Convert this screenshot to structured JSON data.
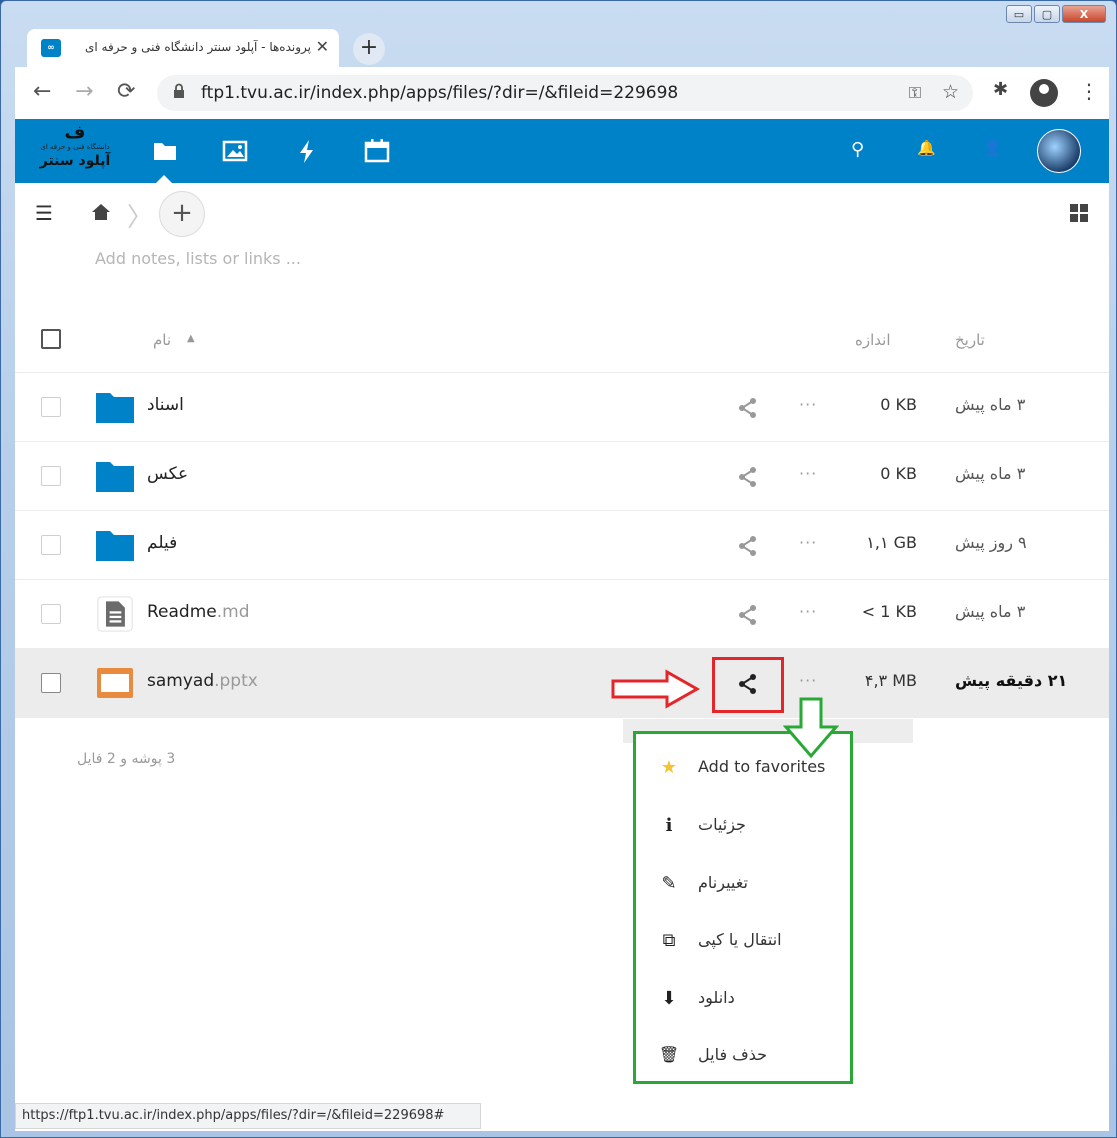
{
  "window": {
    "controls": {
      "minimize": "▭",
      "maximize": "▢",
      "close": "X"
    }
  },
  "tab": {
    "favicon_text": "∞",
    "title": "پرونده‌ها - آپلود سنتر دانشگاه فنی و حرفه ای",
    "close_glyph": "✕",
    "new_tab_glyph": "+"
  },
  "toolbar": {
    "back_glyph": "←",
    "forward_glyph": "→",
    "reload_glyph": "⟳",
    "url": "ftp1.tvu.ac.ir/index.php/apps/files/?dir=/&fileid=229698",
    "key_glyph": "⚿",
    "star_glyph": "☆",
    "extensions_glyph": "✱",
    "menu_glyph": "⋮"
  },
  "header": {
    "logo_mark": "ف",
    "logo_subtext": "دانشگاه فنی و حرفه ای",
    "logo_text": "آپلود سنتر",
    "search_glyph": "⚲",
    "bell_glyph": "🔔",
    "contacts_glyph": "👤"
  },
  "breadcrumb": {
    "hamburger_glyph": "☰",
    "separator": "〉",
    "add_glyph": "+"
  },
  "notes": {
    "placeholder": "Add notes, lists or links ..."
  },
  "list_header": {
    "name": "نام",
    "sort_glyph": "▲",
    "size": "اندازه",
    "date": "تاریخ"
  },
  "files": [
    {
      "name": "اسناد",
      "ext": "",
      "type": "folder",
      "size": "0 KB",
      "date": "۳ ماه پیش"
    },
    {
      "name": "عکس",
      "ext": "",
      "type": "folder",
      "size": "0 KB",
      "date": "۳ ماه پیش"
    },
    {
      "name": "فیلم",
      "ext": "",
      "type": "folder",
      "size": "۱,۱ GB",
      "date": "۹ روز پیش"
    },
    {
      "name": "Readme",
      "ext": ".md",
      "type": "text",
      "size": "< 1 KB",
      "date": "۳ ماه پیش"
    },
    {
      "name": "samyad",
      "ext": ".pptx",
      "type": "presentation",
      "size": "۴,۳ MB",
      "date": "۲۱ دقیقه پیش"
    }
  ],
  "more_glyph": "···",
  "summary": "3 پوشه و 2 فایل",
  "context_menu": [
    {
      "icon": "star-icon",
      "glyph": "★",
      "label": "Add to favorites"
    },
    {
      "icon": "info-icon",
      "glyph": "i",
      "label": "جزئیات"
    },
    {
      "icon": "pencil-icon",
      "glyph": "✎",
      "label": "تغییرنام"
    },
    {
      "icon": "external-icon",
      "glyph": "⧉",
      "label": "انتقال یا کپی"
    },
    {
      "icon": "download-icon",
      "glyph": "⬇",
      "label": "دانلود"
    },
    {
      "icon": "trash-icon",
      "glyph": "🗑",
      "label": "حذف فایل"
    }
  ],
  "statusbar": {
    "url": "https://ftp1.tvu.ac.ir/index.php/apps/files/?dir=/&fileid=229698#"
  },
  "colors": {
    "brand": "#0082c9",
    "annotation_red": "#e3262a",
    "annotation_green": "#2aa836",
    "favorite_star": "#f4c430"
  }
}
